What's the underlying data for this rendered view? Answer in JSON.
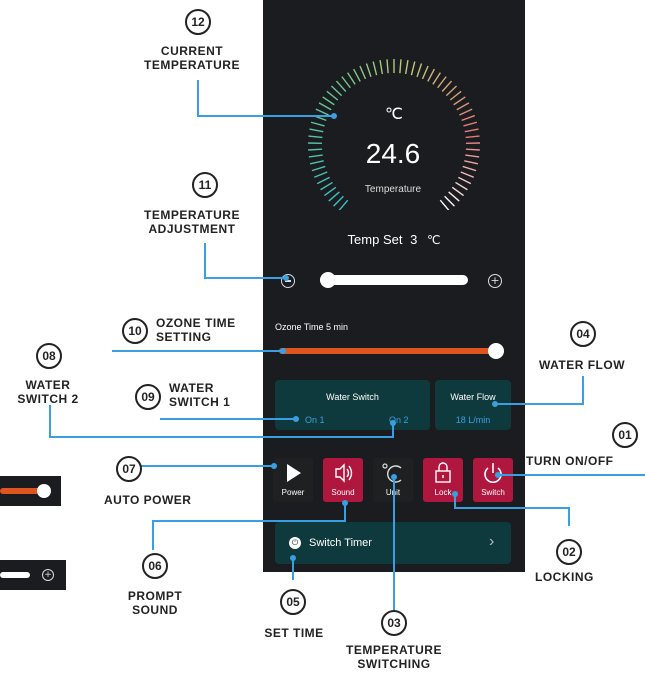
{
  "gauge": {
    "unit": "℃",
    "value": "24.6",
    "label": "Temperature"
  },
  "temp_set": {
    "label": "Temp Set",
    "value": "3",
    "unit": "℃",
    "level": 0.0
  },
  "ozone": {
    "label": "Ozone Time 5 min",
    "level": 1.0
  },
  "water_switch": {
    "title": "Water Switch",
    "on1": "On 1",
    "on2": "On 2"
  },
  "water_flow": {
    "title": "Water Flow",
    "value": "18 L/min"
  },
  "buttons": [
    {
      "label": "Power",
      "icon": "play-icon",
      "color": "#1e2022"
    },
    {
      "label": "Sound",
      "icon": "speaker-icon",
      "color": "#b0173f"
    },
    {
      "label": "Unit",
      "icon": "celsius-icon",
      "color": "#1e2022"
    },
    {
      "label": "Lock",
      "icon": "lock-icon",
      "color": "#b0173f"
    },
    {
      "label": "Switch",
      "icon": "power-icon",
      "color": "#b0173f"
    }
  ],
  "switch_timer": {
    "label": "Switch Timer",
    "chevron": "›"
  },
  "annotations": [
    {
      "num": "01",
      "lines": [
        "TURN ON/OFF"
      ]
    },
    {
      "num": "02",
      "lines": [
        "LOCKING"
      ]
    },
    {
      "num": "03",
      "lines": [
        "TEMPERATURE",
        "SWITCHING"
      ]
    },
    {
      "num": "04",
      "lines": [
        "WATER FLOW"
      ]
    },
    {
      "num": "05",
      "lines": [
        "SET TIME"
      ]
    },
    {
      "num": "06",
      "lines": [
        "PROMPT",
        "SOUND"
      ]
    },
    {
      "num": "07",
      "lines": [
        "AUTO POWER"
      ]
    },
    {
      "num": "08",
      "lines": [
        "WATER",
        "SWITCH 2"
      ]
    },
    {
      "num": "09",
      "lines": [
        "WATER",
        "SWITCH 1"
      ]
    },
    {
      "num": "10",
      "lines": [
        "OZONE TIME",
        "SETTING"
      ]
    },
    {
      "num": "11",
      "lines": [
        "TEMPERATURE",
        "ADJUSTMENT"
      ]
    },
    {
      "num": "12",
      "lines": [
        "CURRENT",
        "TEMPERATURE"
      ]
    }
  ],
  "colors": {
    "accent": "#3a9fe0",
    "ozone_track": "#e0541f",
    "card": "#0f3a3d",
    "button_red": "#b0173f",
    "screen": "#1a1c1f"
  }
}
